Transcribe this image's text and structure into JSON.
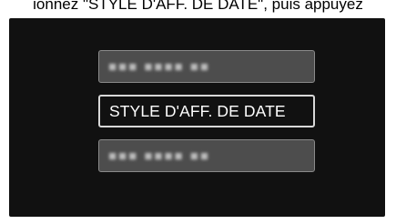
{
  "caption": "ionnez \"STYLE D'AFF. DE DATE\", puis appuyez",
  "menu": {
    "items": [
      {
        "label": "",
        "state": "dim"
      },
      {
        "label": "STYLE D'AFF. DE DATE",
        "state": "selected"
      },
      {
        "label": "",
        "state": "dim"
      }
    ]
  }
}
